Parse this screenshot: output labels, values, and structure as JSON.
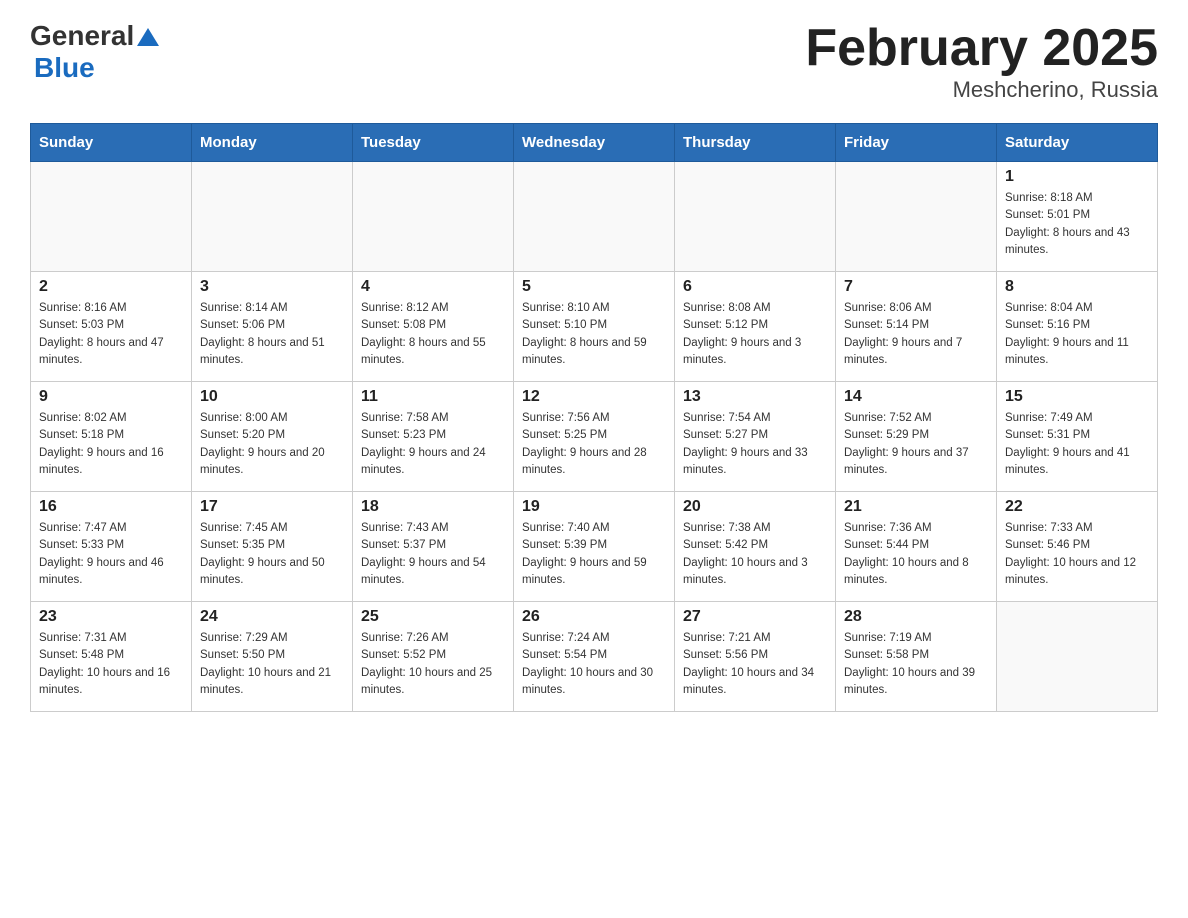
{
  "header": {
    "logo_general": "General",
    "logo_blue": "Blue",
    "title": "February 2025",
    "subtitle": "Meshcherino, Russia"
  },
  "days_of_week": [
    "Sunday",
    "Monday",
    "Tuesday",
    "Wednesday",
    "Thursday",
    "Friday",
    "Saturday"
  ],
  "weeks": [
    [
      {
        "day": "",
        "sunrise": "",
        "sunset": "",
        "daylight": ""
      },
      {
        "day": "",
        "sunrise": "",
        "sunset": "",
        "daylight": ""
      },
      {
        "day": "",
        "sunrise": "",
        "sunset": "",
        "daylight": ""
      },
      {
        "day": "",
        "sunrise": "",
        "sunset": "",
        "daylight": ""
      },
      {
        "day": "",
        "sunrise": "",
        "sunset": "",
        "daylight": ""
      },
      {
        "day": "",
        "sunrise": "",
        "sunset": "",
        "daylight": ""
      },
      {
        "day": "1",
        "sunrise": "Sunrise: 8:18 AM",
        "sunset": "Sunset: 5:01 PM",
        "daylight": "Daylight: 8 hours and 43 minutes."
      }
    ],
    [
      {
        "day": "2",
        "sunrise": "Sunrise: 8:16 AM",
        "sunset": "Sunset: 5:03 PM",
        "daylight": "Daylight: 8 hours and 47 minutes."
      },
      {
        "day": "3",
        "sunrise": "Sunrise: 8:14 AM",
        "sunset": "Sunset: 5:06 PM",
        "daylight": "Daylight: 8 hours and 51 minutes."
      },
      {
        "day": "4",
        "sunrise": "Sunrise: 8:12 AM",
        "sunset": "Sunset: 5:08 PM",
        "daylight": "Daylight: 8 hours and 55 minutes."
      },
      {
        "day": "5",
        "sunrise": "Sunrise: 8:10 AM",
        "sunset": "Sunset: 5:10 PM",
        "daylight": "Daylight: 8 hours and 59 minutes."
      },
      {
        "day": "6",
        "sunrise": "Sunrise: 8:08 AM",
        "sunset": "Sunset: 5:12 PM",
        "daylight": "Daylight: 9 hours and 3 minutes."
      },
      {
        "day": "7",
        "sunrise": "Sunrise: 8:06 AM",
        "sunset": "Sunset: 5:14 PM",
        "daylight": "Daylight: 9 hours and 7 minutes."
      },
      {
        "day": "8",
        "sunrise": "Sunrise: 8:04 AM",
        "sunset": "Sunset: 5:16 PM",
        "daylight": "Daylight: 9 hours and 11 minutes."
      }
    ],
    [
      {
        "day": "9",
        "sunrise": "Sunrise: 8:02 AM",
        "sunset": "Sunset: 5:18 PM",
        "daylight": "Daylight: 9 hours and 16 minutes."
      },
      {
        "day": "10",
        "sunrise": "Sunrise: 8:00 AM",
        "sunset": "Sunset: 5:20 PM",
        "daylight": "Daylight: 9 hours and 20 minutes."
      },
      {
        "day": "11",
        "sunrise": "Sunrise: 7:58 AM",
        "sunset": "Sunset: 5:23 PM",
        "daylight": "Daylight: 9 hours and 24 minutes."
      },
      {
        "day": "12",
        "sunrise": "Sunrise: 7:56 AM",
        "sunset": "Sunset: 5:25 PM",
        "daylight": "Daylight: 9 hours and 28 minutes."
      },
      {
        "day": "13",
        "sunrise": "Sunrise: 7:54 AM",
        "sunset": "Sunset: 5:27 PM",
        "daylight": "Daylight: 9 hours and 33 minutes."
      },
      {
        "day": "14",
        "sunrise": "Sunrise: 7:52 AM",
        "sunset": "Sunset: 5:29 PM",
        "daylight": "Daylight: 9 hours and 37 minutes."
      },
      {
        "day": "15",
        "sunrise": "Sunrise: 7:49 AM",
        "sunset": "Sunset: 5:31 PM",
        "daylight": "Daylight: 9 hours and 41 minutes."
      }
    ],
    [
      {
        "day": "16",
        "sunrise": "Sunrise: 7:47 AM",
        "sunset": "Sunset: 5:33 PM",
        "daylight": "Daylight: 9 hours and 46 minutes."
      },
      {
        "day": "17",
        "sunrise": "Sunrise: 7:45 AM",
        "sunset": "Sunset: 5:35 PM",
        "daylight": "Daylight: 9 hours and 50 minutes."
      },
      {
        "day": "18",
        "sunrise": "Sunrise: 7:43 AM",
        "sunset": "Sunset: 5:37 PM",
        "daylight": "Daylight: 9 hours and 54 minutes."
      },
      {
        "day": "19",
        "sunrise": "Sunrise: 7:40 AM",
        "sunset": "Sunset: 5:39 PM",
        "daylight": "Daylight: 9 hours and 59 minutes."
      },
      {
        "day": "20",
        "sunrise": "Sunrise: 7:38 AM",
        "sunset": "Sunset: 5:42 PM",
        "daylight": "Daylight: 10 hours and 3 minutes."
      },
      {
        "day": "21",
        "sunrise": "Sunrise: 7:36 AM",
        "sunset": "Sunset: 5:44 PM",
        "daylight": "Daylight: 10 hours and 8 minutes."
      },
      {
        "day": "22",
        "sunrise": "Sunrise: 7:33 AM",
        "sunset": "Sunset: 5:46 PM",
        "daylight": "Daylight: 10 hours and 12 minutes."
      }
    ],
    [
      {
        "day": "23",
        "sunrise": "Sunrise: 7:31 AM",
        "sunset": "Sunset: 5:48 PM",
        "daylight": "Daylight: 10 hours and 16 minutes."
      },
      {
        "day": "24",
        "sunrise": "Sunrise: 7:29 AM",
        "sunset": "Sunset: 5:50 PM",
        "daylight": "Daylight: 10 hours and 21 minutes."
      },
      {
        "day": "25",
        "sunrise": "Sunrise: 7:26 AM",
        "sunset": "Sunset: 5:52 PM",
        "daylight": "Daylight: 10 hours and 25 minutes."
      },
      {
        "day": "26",
        "sunrise": "Sunrise: 7:24 AM",
        "sunset": "Sunset: 5:54 PM",
        "daylight": "Daylight: 10 hours and 30 minutes."
      },
      {
        "day": "27",
        "sunrise": "Sunrise: 7:21 AM",
        "sunset": "Sunset: 5:56 PM",
        "daylight": "Daylight: 10 hours and 34 minutes."
      },
      {
        "day": "28",
        "sunrise": "Sunrise: 7:19 AM",
        "sunset": "Sunset: 5:58 PM",
        "daylight": "Daylight: 10 hours and 39 minutes."
      },
      {
        "day": "",
        "sunrise": "",
        "sunset": "",
        "daylight": ""
      }
    ]
  ]
}
